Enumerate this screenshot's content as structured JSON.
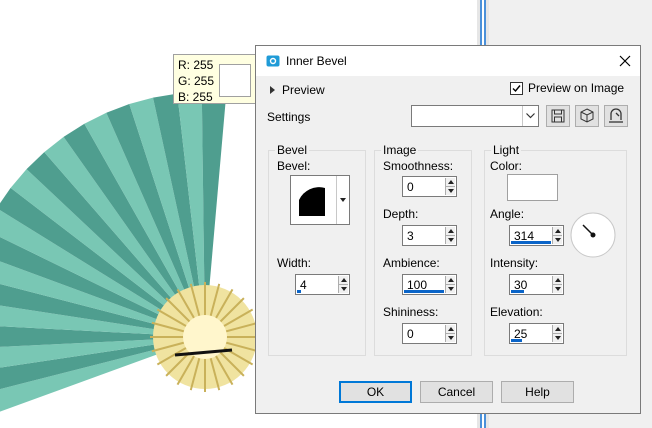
{
  "tooltip": {
    "r": "R: 255",
    "g": "G: 255",
    "b": "B: 255",
    "swatch_color": "#ffffff"
  },
  "dialog": {
    "title": "Inner Bevel",
    "preview_label": "Preview",
    "preview_on_image_label": "Preview on Image",
    "preview_on_image_checked": true,
    "settings_label": "Settings",
    "settings_value": ""
  },
  "bevel": {
    "group_title": "Bevel",
    "bevel_label": "Bevel:",
    "width_label": "Width:",
    "width_value": "4"
  },
  "image": {
    "group_title": "Image",
    "smoothness_label": "Smoothness:",
    "smoothness_value": "0",
    "depth_label": "Depth:",
    "depth_value": "3",
    "ambience_label": "Ambience:",
    "ambience_value": "100",
    "shininess_label": "Shininess:",
    "shininess_value": "0"
  },
  "light": {
    "group_title": "Light",
    "color_label": "Color:",
    "color_value": "#ffffff",
    "angle_label": "Angle:",
    "angle_value": "314",
    "intensity_label": "Intensity:",
    "intensity_value": "30",
    "elevation_label": "Elevation:",
    "elevation_value": "25"
  },
  "buttons": {
    "ok": "OK",
    "cancel": "Cancel",
    "help": "Help"
  },
  "colors": {
    "accent": "#0078d7",
    "fan_teal": "#5fb5a3",
    "fan_gold": "#e8d58a"
  }
}
